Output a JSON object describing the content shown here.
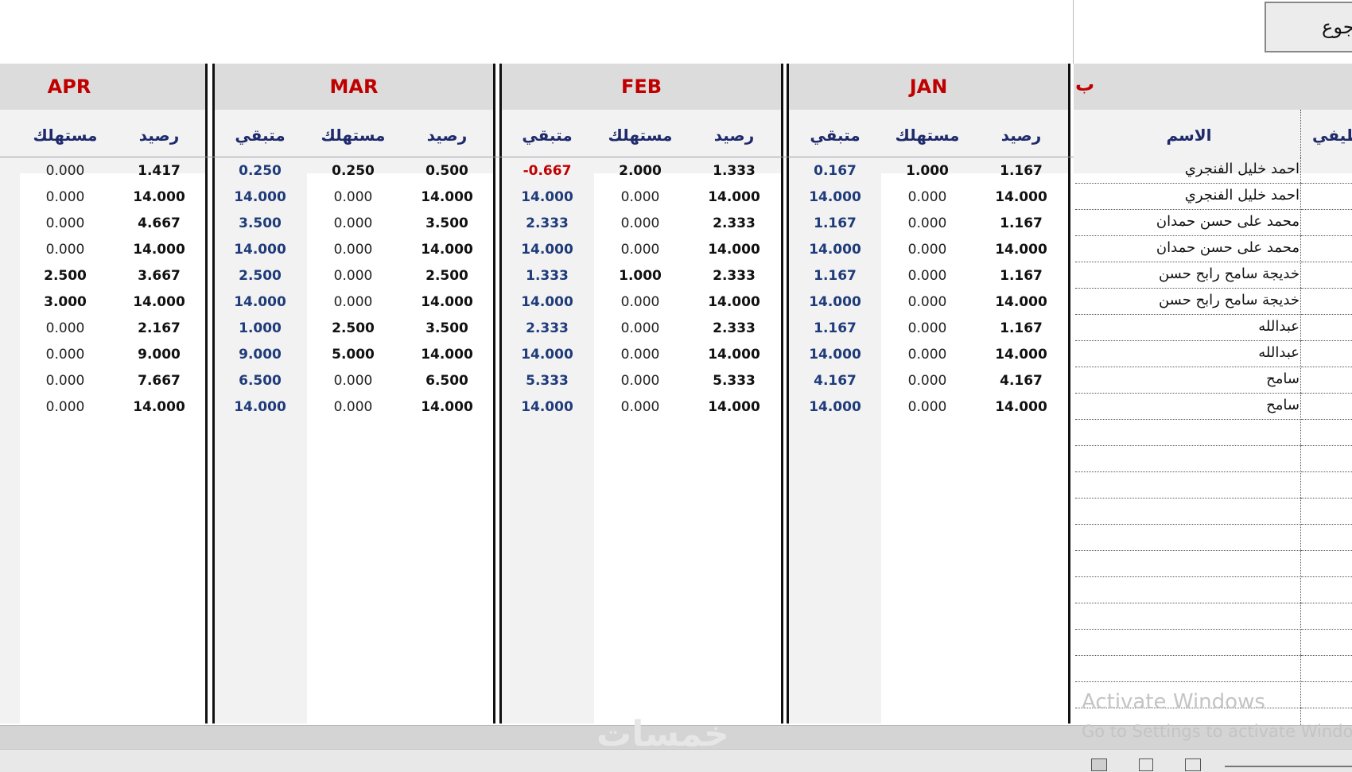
{
  "top_button_label": "جوع",
  "names_header_fragment": "ب",
  "names_col_header": "الاسم",
  "partial_col_header": "ظيفي",
  "sub_headers": {
    "balance": "رصيد",
    "consumed": "مستهلك",
    "remaining": "متبقي"
  },
  "months": [
    {
      "name": "JAN",
      "balance": [
        "1.167",
        "14.000",
        "1.167",
        "14.000",
        "1.167",
        "14.000",
        "1.167",
        "14.000",
        "4.167",
        "14.000"
      ],
      "consumed": [
        "1.000",
        "0.000",
        "0.000",
        "0.000",
        "0.000",
        "0.000",
        "0.000",
        "0.000",
        "0.000",
        "0.000"
      ],
      "remaining": [
        "0.167",
        "14.000",
        "1.167",
        "14.000",
        "1.167",
        "14.000",
        "1.167",
        "14.000",
        "4.167",
        "14.000"
      ]
    },
    {
      "name": "FEB",
      "balance": [
        "1.333",
        "14.000",
        "2.333",
        "14.000",
        "2.333",
        "14.000",
        "2.333",
        "14.000",
        "5.333",
        "14.000"
      ],
      "consumed": [
        "2.000",
        "0.000",
        "0.000",
        "0.000",
        "1.000",
        "0.000",
        "0.000",
        "0.000",
        "0.000",
        "0.000"
      ],
      "remaining": [
        "-0.667",
        "14.000",
        "2.333",
        "14.000",
        "1.333",
        "14.000",
        "2.333",
        "14.000",
        "5.333",
        "14.000"
      ]
    },
    {
      "name": "MAR",
      "balance": [
        "0.500",
        "14.000",
        "3.500",
        "14.000",
        "2.500",
        "14.000",
        "3.500",
        "14.000",
        "6.500",
        "14.000"
      ],
      "consumed": [
        "0.250",
        "0.000",
        "0.000",
        "0.000",
        "0.000",
        "0.000",
        "2.500",
        "5.000",
        "0.000",
        "0.000"
      ],
      "remaining": [
        "0.250",
        "14.000",
        "3.500",
        "14.000",
        "2.500",
        "14.000",
        "1.000",
        "9.000",
        "6.500",
        "14.000"
      ]
    },
    {
      "name": "APR",
      "balance": [
        "1.417",
        "14.000",
        "4.667",
        "14.000",
        "3.667",
        "14.000",
        "2.167",
        "9.000",
        "7.667",
        "14.000"
      ],
      "consumed": [
        "0.000",
        "0.000",
        "0.000",
        "0.000",
        "2.500",
        "3.000",
        "0.000",
        "0.000",
        "0.000",
        "0.000"
      ]
    }
  ],
  "names": [
    "احمد خليل الفنجري",
    "احمد خليل الفنجري",
    "محمد على حسن حمدان",
    "محمد على حسن حمدان",
    "خديجة سامح رابح حسن",
    "خديجة سامح رابح حسن",
    "عبدالله",
    "عبدالله",
    "سامح",
    "سامح"
  ],
  "watermark_line1": "Activate Windows",
  "watermark_line2": "Go to Settings to activate Windows",
  "site_watermark": "خمسات"
}
